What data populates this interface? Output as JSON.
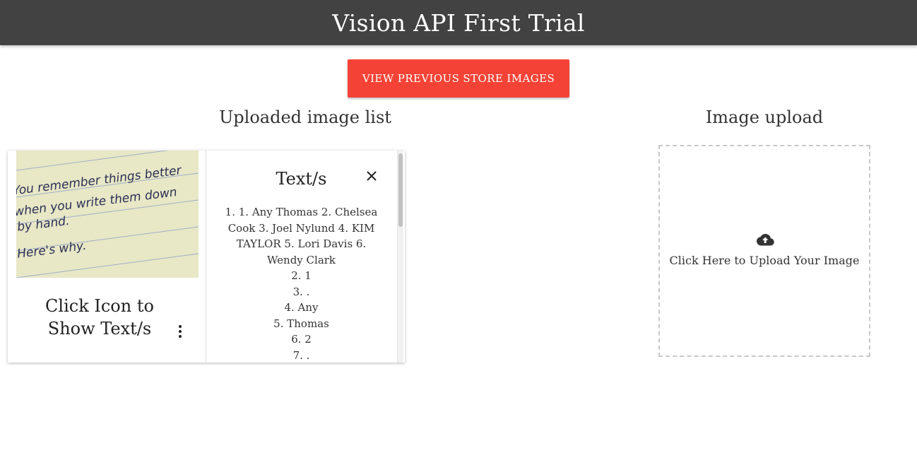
{
  "header": {
    "title": "Vision API First Trial"
  },
  "actions": {
    "view_previous_label": "VIEW PREVIOUS STORE IMAGES"
  },
  "left_section": {
    "heading": "Uploaded image list",
    "card": {
      "footer_title": "Click Icon to Show Text/s",
      "more_icon": "more-vert-icon",
      "image_handwriting": [
        "You remember things better",
        "when you write them down",
        "by hand.",
        "Here's why."
      ],
      "reveal": {
        "title": "Text/s",
        "close_icon": "close-icon",
        "lines": [
          "1. 1. Any Thomas 2. Chelsea Cook 3. Joel Nylund 4. KIM TAYLOR 5. Lori Davis 6. Wendy Clark",
          "2. 1",
          "3. .",
          "4. Any",
          "5. Thomas",
          "6. 2",
          "7. ."
        ]
      }
    }
  },
  "right_section": {
    "heading": "Image upload",
    "upload_label": "Click Here to Upload Your Image",
    "upload_icon": "cloud-upload-icon"
  },
  "colors": {
    "navbar": "#424242",
    "accent_button": "#f44336",
    "upload_border": "#c8c8c8"
  }
}
